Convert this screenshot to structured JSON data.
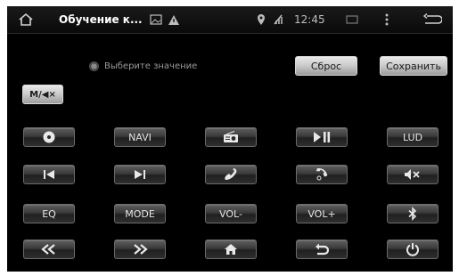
{
  "status_bar": {
    "title": "Обучение к...",
    "time": "12:45",
    "icons": [
      "home-icon",
      "image-icon",
      "warning-icon",
      "location-icon",
      "signal-icon",
      "sd-card-icon",
      "more-icon",
      "back-icon"
    ]
  },
  "hint": {
    "text": "Выберите значение"
  },
  "top_buttons": {
    "reset": "Сброс",
    "save": "Сохранить"
  },
  "mute_mode_button": "M/◀×",
  "grid": {
    "rows": [
      [
        {
          "name": "source-button",
          "icon": "disc-icon",
          "label": ""
        },
        {
          "name": "navi-button",
          "icon": "",
          "label": "NAVI"
        },
        {
          "name": "radio-button",
          "icon": "radio-icon",
          "label": ""
        },
        {
          "name": "play-pause-button",
          "icon": "play-pause-icon",
          "label": ""
        },
        {
          "name": "lud-button",
          "icon": "",
          "label": "LUD"
        }
      ],
      [
        {
          "name": "previous-track-button",
          "icon": "skip-previous-icon",
          "label": ""
        },
        {
          "name": "next-track-button",
          "icon": "skip-next-icon",
          "label": ""
        },
        {
          "name": "answer-call-button",
          "icon": "phone-icon",
          "label": ""
        },
        {
          "name": "hang-up-button",
          "icon": "hang-up-icon",
          "label": ""
        },
        {
          "name": "mute-button",
          "icon": "mute-icon",
          "label": ""
        }
      ],
      [
        {
          "name": "eq-button",
          "icon": "",
          "label": "EQ"
        },
        {
          "name": "mode-button",
          "icon": "",
          "label": "MODE"
        },
        {
          "name": "volume-down-button",
          "icon": "",
          "label": "VOL-"
        },
        {
          "name": "volume-up-button",
          "icon": "",
          "label": "VOL+"
        },
        {
          "name": "bluetooth-button",
          "icon": "bluetooth-icon",
          "label": ""
        }
      ],
      [
        {
          "name": "rewind-button",
          "icon": "rewind-icon",
          "label": ""
        },
        {
          "name": "fast-forward-button",
          "icon": "fast-forward-icon",
          "label": ""
        },
        {
          "name": "home-button",
          "icon": "home-icon",
          "label": ""
        },
        {
          "name": "back-button",
          "icon": "back-icon",
          "label": ""
        },
        {
          "name": "power-button",
          "icon": "power-icon",
          "label": ""
        }
      ]
    ]
  },
  "colors": {
    "background": "#000000",
    "button_light": "#c9c9c9",
    "button_dark": "#3a3a3a"
  }
}
